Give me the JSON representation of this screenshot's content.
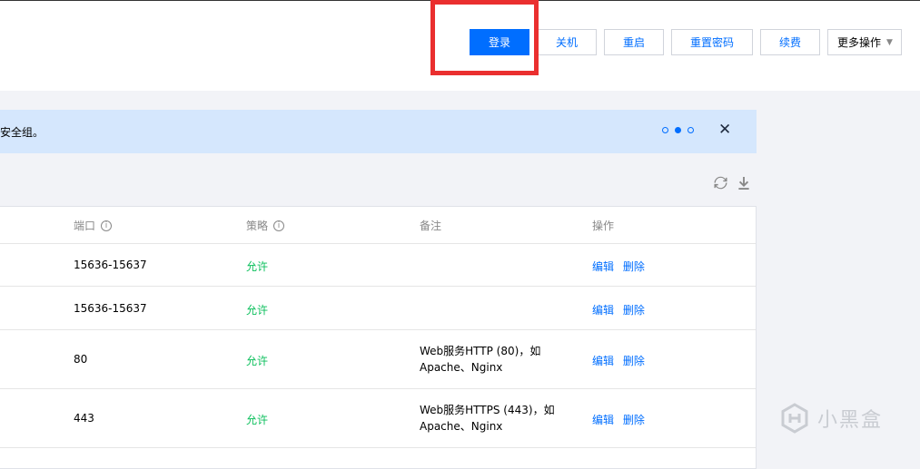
{
  "toolbar": {
    "login": "登录",
    "shutdown": "关机",
    "restart": "重启",
    "reset_password": "重置密码",
    "renew": "续费",
    "more_actions": "更多操作"
  },
  "notice": {
    "text": "安全组。",
    "close_icon": "close-icon",
    "pager_icons": [
      "dot",
      "dot-active",
      "dot"
    ]
  },
  "tools": {
    "refresh_icon": "refresh-icon",
    "download_icon": "download-icon"
  },
  "table": {
    "headers": {
      "port": "端口",
      "policy": "策略",
      "note": "备注",
      "actions": "操作"
    },
    "rows": [
      {
        "port": "15636-15637",
        "policy": "允许",
        "note_line1": "",
        "note_line2": "",
        "edit": "编辑",
        "delete": "删除"
      },
      {
        "port": "15636-15637",
        "policy": "允许",
        "note_line1": "",
        "note_line2": "",
        "edit": "编辑",
        "delete": "删除"
      },
      {
        "port": "80",
        "policy": "允许",
        "note_line1": "Web服务HTTP (80)，如",
        "note_line2": "Apache、Nginx",
        "edit": "编辑",
        "delete": "删除"
      },
      {
        "port": "443",
        "policy": "允许",
        "note_line1": "Web服务HTTPS (443)，如",
        "note_line2": "Apache、Nginx",
        "edit": "编辑",
        "delete": "删除"
      }
    ]
  },
  "watermark": {
    "text": "小黑盒"
  },
  "colors": {
    "primary": "#006eff",
    "allow": "#0abf5b",
    "highlight": "#ea2f2f",
    "notice_bg": "#d5e7fd"
  }
}
